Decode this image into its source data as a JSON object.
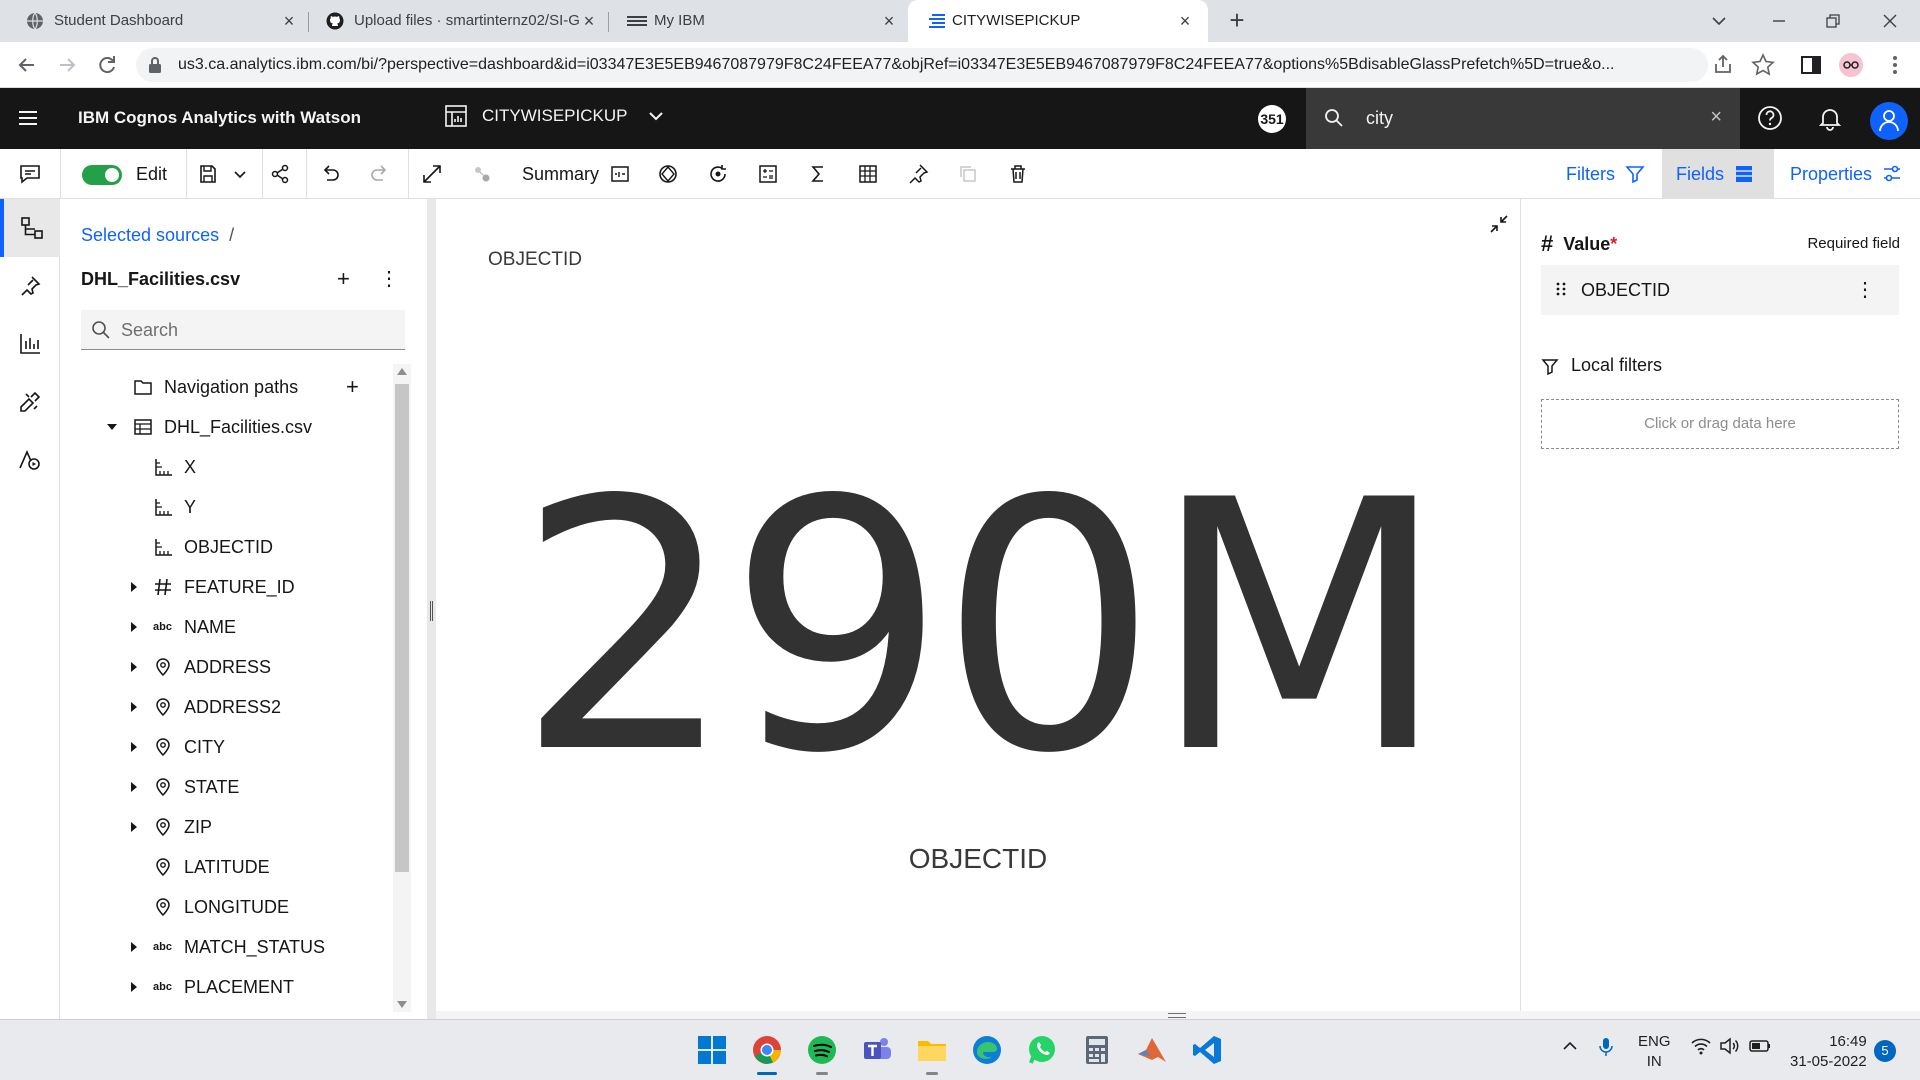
{
  "browser": {
    "tabs": [
      {
        "title": "Student Dashboard",
        "icon": "globe-icon",
        "active": false
      },
      {
        "title": "Upload files · smartinternz02/SI-G",
        "icon": "github-icon",
        "active": false
      },
      {
        "title": "My IBM",
        "icon": "ibm-icon",
        "active": false
      },
      {
        "title": "CITYWISEPICKUP",
        "icon": "cognos-icon",
        "active": true
      }
    ],
    "url": "us3.ca.analytics.ibm.com/bi/?perspective=dashboard&id=i03347E3E5EB9467087979F8C24FEEA77&objRef=i03347E3E5EB9467087979F8C24FEEA77&options%5BdisableGlassPrefetch%5D=true&o..."
  },
  "header": {
    "brand": "IBM Cognos Analytics with Watson",
    "dashboard_name": "CITYWISEPICKUP",
    "badge": "351",
    "search_value": "city"
  },
  "toolbar": {
    "edit_label": "Edit",
    "summary_label": "Summary",
    "tabs": {
      "filters": "Filters",
      "fields": "Fields",
      "properties": "Properties"
    }
  },
  "sources": {
    "breadcrumb": "Selected sources",
    "breadcrumb_sep": "/",
    "title": "DHL_Facilities.csv",
    "search_placeholder": "Search",
    "tree": [
      {
        "label": "Navigation paths",
        "icon": "folder-icon"
      },
      {
        "label": "DHL_Facilities.csv",
        "icon": "table-icon"
      },
      {
        "label": "X",
        "icon": "measure-icon"
      },
      {
        "label": "Y",
        "icon": "measure-icon"
      },
      {
        "label": "OBJECTID",
        "icon": "measure-icon"
      },
      {
        "label": "FEATURE_ID",
        "icon": "hash-icon"
      },
      {
        "label": "NAME",
        "icon": "text-icon"
      },
      {
        "label": "ADDRESS",
        "icon": "location-icon"
      },
      {
        "label": "ADDRESS2",
        "icon": "location-icon"
      },
      {
        "label": "CITY",
        "icon": "location-icon"
      },
      {
        "label": "STATE",
        "icon": "location-icon"
      },
      {
        "label": "ZIP",
        "icon": "location-icon"
      },
      {
        "label": "LATITUDE",
        "icon": "location-icon"
      },
      {
        "label": "LONGITUDE",
        "icon": "location-icon"
      },
      {
        "label": "MATCH_STATUS",
        "icon": "text-icon"
      },
      {
        "label": "PLACEMENT",
        "icon": "text-icon"
      }
    ]
  },
  "widget": {
    "title": "OBJECTID",
    "kpi_value": "290M",
    "kpi_label": "OBJECTID"
  },
  "props": {
    "value_label": "Value",
    "required_star": "*",
    "required_note": "Required field",
    "field_name": "OBJECTID",
    "local_filters": "Local filters",
    "drop_hint": "Click or drag data here"
  },
  "taskbar": {
    "lang": "ENG",
    "region": "IN",
    "time": "16:49",
    "date": "31-05-2022",
    "notifications": "5"
  },
  "colors": {
    "accent": "#0f62fe",
    "toggle_on": "#24a148",
    "header_bg": "#161616"
  }
}
